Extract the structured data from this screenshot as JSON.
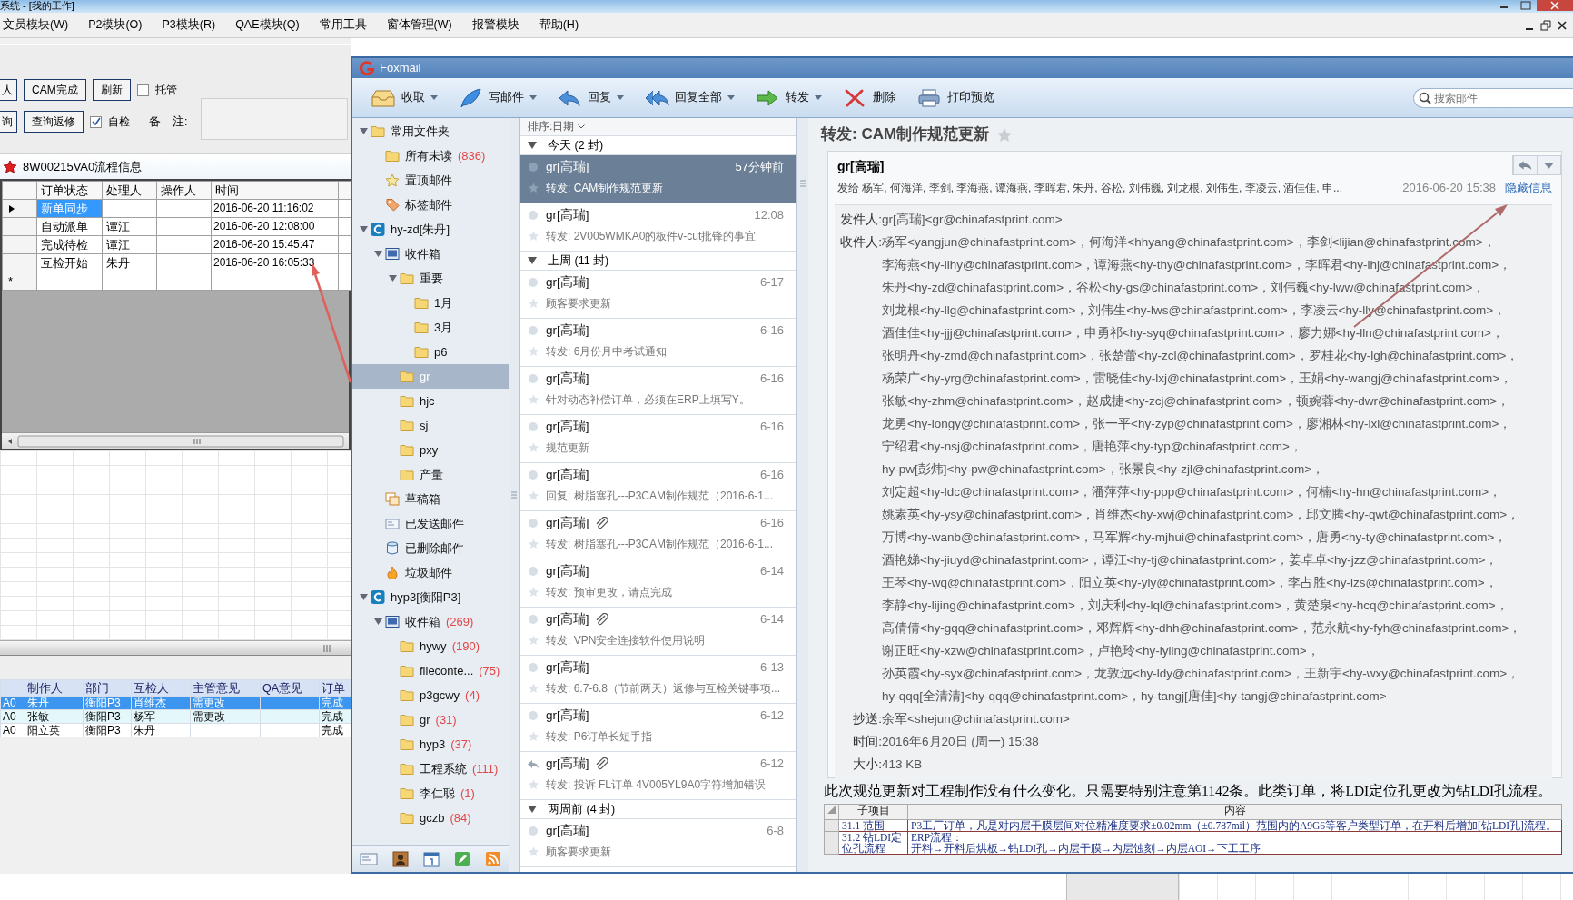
{
  "app": {
    "title": "系统 - [我的工作]",
    "menu": [
      "文员模块(W)",
      "P2模块(O)",
      "P3模块(R)",
      "QAE模块(Q)",
      "常用工具",
      "窗体管理(W)",
      "报警模块",
      "帮助(H)"
    ],
    "actions": [
      {
        "kind": "button",
        "label": "人"
      },
      {
        "kind": "button",
        "label": "CAM完成"
      },
      {
        "kind": "button",
        "label": "刷新"
      },
      {
        "kind": "checkbox",
        "label": "托管",
        "checked": false
      }
    ],
    "actions_row2": [
      {
        "kind": "button",
        "label": "询"
      },
      {
        "kind": "button",
        "label": "查询返修"
      },
      {
        "kind": "checkbox",
        "label": "自检",
        "checked": true
      }
    ],
    "remark_label": "备　注:",
    "flow": {
      "title": "8W00215VA0流程信息",
      "columns": [
        "订单状态",
        "处理人",
        "操作人",
        "时间"
      ],
      "rows": [
        {
          "current": true,
          "selected": true,
          "cells": [
            "新单同步",
            null,
            null,
            "2016-06-20 11:16:02"
          ]
        },
        {
          "current": false,
          "selected": false,
          "cells": [
            "自动派单",
            "谭江",
            null,
            "2016-06-20 12:08:00"
          ]
        },
        {
          "current": false,
          "selected": false,
          "cells": [
            "完成待检",
            "谭江",
            null,
            "2016-06-20 15:45:47"
          ]
        },
        {
          "current": false,
          "selected": false,
          "cells": [
            "互检开始",
            "朱丹",
            null,
            "2016-06-20 16:05:33"
          ]
        }
      ],
      "new_row_marker": "*"
    },
    "orders": {
      "columns": [
        "制作人",
        "部门",
        "互检人",
        "主管意见",
        "QA意见",
        "订单"
      ],
      "rows": [
        {
          "lead": "A0",
          "selected": true,
          "cells": [
            "朱丹",
            "衡阳P3",
            "肖维杰",
            "需更改",
            null,
            "完成"
          ]
        },
        {
          "lead": "A0",
          "selected": false,
          "cells": [
            "张敏",
            "衡阳P3",
            "杨军",
            "需更改",
            null,
            "完成"
          ]
        },
        {
          "lead": "A0",
          "selected": false,
          "cells": [
            "阳立英",
            "衡阳P3",
            "朱丹",
            null,
            null,
            "完成"
          ]
        }
      ]
    }
  },
  "foxmail": {
    "title": "Foxmail",
    "toolbar": [
      {
        "kind": "receive",
        "label": "收取",
        "dropdown": true
      },
      {
        "kind": "compose",
        "label": "写邮件",
        "dropdown": true
      },
      {
        "kind": "reply",
        "label": "回复",
        "dropdown": true
      },
      {
        "kind": "replyall",
        "label": "回复全部",
        "dropdown": true
      },
      {
        "kind": "forward",
        "label": "转发",
        "dropdown": true
      },
      {
        "kind": "delete",
        "label": "删除",
        "dropdown": false
      },
      {
        "kind": "print",
        "label": "打印预览",
        "dropdown": false
      }
    ],
    "search": {
      "placeholder": "搜索邮件"
    },
    "folders": [
      {
        "label": "常用文件夹",
        "kind": "folder",
        "expanded": true,
        "selected": false,
        "children": [
          {
            "label": "所有未读",
            "kind": "folder",
            "count": "(836)",
            "selected": false
          },
          {
            "label": "置顶邮件",
            "kind": "starred",
            "selected": false
          },
          {
            "label": "标签邮件",
            "kind": "tagged",
            "selected": false
          }
        ]
      },
      {
        "label": "hy-zd[朱丹]",
        "kind": "account",
        "expanded": true,
        "selected": false,
        "children": [
          {
            "label": "收件箱",
            "kind": "inbox",
            "expanded": true,
            "selected": false,
            "children": [
              {
                "label": "重要",
                "kind": "folder",
                "expanded": true,
                "selected": false,
                "children": [
                  {
                    "label": "1月",
                    "kind": "folder",
                    "selected": false
                  },
                  {
                    "label": "3月",
                    "kind": "folder",
                    "selected": false
                  },
                  {
                    "label": "p6",
                    "kind": "folder",
                    "selected": false
                  }
                ]
              },
              {
                "label": "gr",
                "kind": "folder",
                "selected": true
              },
              {
                "label": "hjc",
                "kind": "folder",
                "selected": false
              },
              {
                "label": "sj",
                "kind": "folder",
                "selected": false
              },
              {
                "label": "pxy",
                "kind": "folder",
                "selected": false
              },
              {
                "label": "产量",
                "kind": "folder",
                "selected": false
              }
            ]
          },
          {
            "label": "草稿箱",
            "kind": "drafts",
            "selected": false
          },
          {
            "label": "已发送邮件",
            "kind": "sent",
            "selected": false
          },
          {
            "label": "已删除邮件",
            "kind": "deleted",
            "selected": false
          },
          {
            "label": "垃圾邮件",
            "kind": "junk",
            "selected": false
          }
        ]
      },
      {
        "label": "hyp3[衡阳P3]",
        "kind": "account",
        "expanded": true,
        "selected": false,
        "children": [
          {
            "label": "收件箱",
            "kind": "inbox",
            "count": "(269)",
            "expanded": true,
            "selected": false,
            "children": [
              {
                "label": "hywy",
                "kind": "folder",
                "count": "(190)",
                "selected": false
              },
              {
                "label": "fileconte...",
                "kind": "folder",
                "count": "(75)",
                "selected": false
              },
              {
                "label": "p3gcwy",
                "kind": "folder",
                "count": "(4)",
                "selected": false
              },
              {
                "label": "gr",
                "kind": "folder",
                "count": "(31)",
                "selected": false
              },
              {
                "label": "hyp3",
                "kind": "folder",
                "count": "(37)",
                "selected": false
              },
              {
                "label": "工程系统",
                "kind": "folder",
                "count": "(111)",
                "selected": false
              },
              {
                "label": "李仁聪",
                "kind": "folder",
                "count": "(1)",
                "selected": false
              },
              {
                "label": "gczb",
                "kind": "folder",
                "count": "(84)",
                "selected": false
              }
            ]
          }
        ]
      }
    ],
    "sort": "排序:日期",
    "groups": [
      {
        "label": "今天 (2 封)",
        "expanded": true,
        "messages": [
          {
            "sender": "gr[高瑞]",
            "time": "57分钟前",
            "subject": "转发: CAM制作规范更新",
            "selected": true,
            "attachment": false,
            "replied": false
          },
          {
            "sender": "gr[高瑞]",
            "time": "12:08",
            "subject": "转发: 2V005WMKA0的板件v-cut批锋的事宜",
            "selected": false,
            "attachment": false,
            "replied": false
          }
        ]
      },
      {
        "label": "上周 (11 封)",
        "expanded": true,
        "messages": [
          {
            "sender": "gr[高瑞]",
            "time": "6-17",
            "subject": "顾客要求更新",
            "selected": false,
            "attachment": false,
            "replied": false
          },
          {
            "sender": "gr[高瑞]",
            "time": "6-16",
            "subject": "转发: 6月份月中考试通知",
            "selected": false,
            "attachment": false,
            "replied": false
          },
          {
            "sender": "gr[高瑞]",
            "time": "6-16",
            "subject": "针对动态补偿订单，必须在ERP上填写Y。",
            "selected": false,
            "attachment": false,
            "replied": false
          },
          {
            "sender": "gr[高瑞]",
            "time": "6-16",
            "subject": "规范更新",
            "selected": false,
            "attachment": false,
            "replied": false
          },
          {
            "sender": "gr[高瑞]",
            "time": "6-16",
            "subject": "回复: 树脂塞孔---P3CAM制作规范（2016-6-1...",
            "selected": false,
            "attachment": false,
            "replied": false
          },
          {
            "sender": "gr[高瑞]",
            "time": "6-16",
            "subject": "转发: 树脂塞孔---P3CAM制作规范（2016-6-1...",
            "selected": false,
            "attachment": true,
            "replied": false
          },
          {
            "sender": "gr[高瑞]",
            "time": "6-14",
            "subject": "转发: 预审更改，请点完成",
            "selected": false,
            "attachment": false,
            "replied": false
          },
          {
            "sender": "gr[高瑞]",
            "time": "6-14",
            "subject": "转发: VPN安全连接软件使用说明",
            "selected": false,
            "attachment": true,
            "replied": false
          },
          {
            "sender": "gr[高瑞]",
            "time": "6-13",
            "subject": "转发: 6.7-6.8（节前两天）返修与互检关键事项...",
            "selected": false,
            "attachment": false,
            "replied": false
          },
          {
            "sender": "gr[高瑞]",
            "time": "6-12",
            "subject": "转发: P6订单长短手指",
            "selected": false,
            "attachment": false,
            "replied": false
          },
          {
            "sender": "gr[高瑞]",
            "time": "6-12",
            "subject": "转发: 投诉 FL订单  4V005YL9A0字符增加错误",
            "selected": false,
            "attachment": true,
            "replied": true
          }
        ]
      },
      {
        "label": "两周前 (4 封)",
        "expanded": true,
        "messages": [
          {
            "sender": "gr[高瑞]",
            "time": "6-8",
            "subject": "顾客要求更新",
            "selected": false,
            "attachment": false,
            "replied": false
          }
        ]
      }
    ],
    "message": {
      "subject": "转发: CAM制作规范更新",
      "starred": false,
      "from": "gr[高瑞]",
      "to_summary": "发给 杨军, 何海洋, 李剑, 李海燕, 谭海燕, 李晖君, 朱丹, 谷松, 刘伟巍, 刘龙根, 刘伟生, 李凌云, 酒佳佳, 申...",
      "date": "2016-06-20 15:38",
      "hide_link": "隐藏信息",
      "details": [
        {
          "label": "发件人:",
          "lines": [
            "gr[高瑞]<gr@chinafastprint.com>"
          ]
        },
        {
          "label": "收件人:",
          "lines": [
            "杨军<yangjun@chinafastprint.com>，何海洋<hhyang@chinafastprint.com>，李剑<lijian@chinafastprint.com>，",
            "李海燕<hy-lihy@chinafastprint.com>，谭海燕<hy-thy@chinafastprint.com>，李晖君<hy-lhj@chinafastprint.com>，",
            "朱丹<hy-zd@chinafastprint.com>，谷松<hy-gs@chinafastprint.com>，刘伟巍<hy-lww@chinafastprint.com>，",
            "刘龙根<hy-llg@chinafastprint.com>，刘伟生<hy-lws@chinafastprint.com>，李凌云<hy-lly@chinafastprint.com>，",
            "酒佳佳<hy-jjj@chinafastprint.com>，申勇祁<hy-syq@chinafastprint.com>，廖力娜<hy-lln@chinafastprint.com>，",
            "张明丹<hy-zmd@chinafastprint.com>，张楚蕾<hy-zcl@chinafastprint.com>，罗桂花<hy-lgh@chinafastprint.com>，",
            "杨荣广<hy-yrg@chinafastprint.com>，雷晓佳<hy-lxj@chinafastprint.com>，王娟<hy-wangj@chinafastprint.com>，",
            "张敏<hy-zhm@chinafastprint.com>，赵成捷<hy-zcj@chinafastprint.com>，顿婉蓉<hy-dwr@chinafastprint.com>，",
            "龙勇<hy-longy@chinafastprint.com>，张一平<hy-zyp@chinafastprint.com>，廖湘林<hy-lxl@chinafastprint.com>，",
            "宁绍君<hy-nsj@chinafastprint.com>，唐艳萍<hy-typ@chinafastprint.com>，",
            "hy-pw[彭炜]<hy-pw@chinafastprint.com>，张景良<hy-zjl@chinafastprint.com>，",
            "刘定超<hy-ldc@chinafastprint.com>，潘萍萍<hy-ppp@chinafastprint.com>，何楠<hy-hn@chinafastprint.com>，",
            "姚素英<hy-ysy@chinafastprint.com>，肖维杰<hy-xwj@chinafastprint.com>，邱文腾<hy-qwt@chinafastprint.com>，",
            "万博<hy-wanb@chinafastprint.com>，马军辉<hy-mjhui@chinafastprint.com>，唐勇<hy-ty@chinafastprint.com>，",
            "酒艳娣<hy-jiuyd@chinafastprint.com>，谭江<hy-tj@chinafastprint.com>，姜卓卓<hy-jzz@chinafastprint.com>，",
            "王琴<hy-wq@chinafastprint.com>，阳立英<hy-yly@chinafastprint.com>，李占胜<hy-lzs@chinafastprint.com>，",
            "李静<hy-lijing@chinafastprint.com>，刘庆利<hy-lql@chinafastprint.com>，黄楚泉<hy-hcq@chinafastprint.com>，",
            "高倩倩<hy-gqq@chinafastprint.com>，邓辉辉<hy-dhh@chinafastprint.com>，范永航<hy-fyh@chinafastprint.com>，",
            "谢正旺<hy-xzw@chinafastprint.com>，卢艳玲<hy-lyling@chinafastprint.com>，",
            "孙英霞<hy-syx@chinafastprint.com>，龙敦远<hy-ldy@chinafastprint.com>，王新宇<hy-wxy@chinafastprint.com>，",
            "hy-qqq[全清清]<hy-qqq@chinafastprint.com>，hy-tangj[唐佳]<hy-tangj@chinafastprint.com>"
          ]
        },
        {
          "label": "抄送:",
          "lines": [
            "余军<shejun@chinafastprint.com>"
          ]
        },
        {
          "label": "时间:",
          "lines": [
            "2016年6月20日 (周一) 15:38"
          ]
        },
        {
          "label": "大小:",
          "lines": [
            "413 KB"
          ]
        }
      ],
      "body": "此次规范更新对工程制作没有什么变化。只需要特别注意第1142条。此类订单，将LDI定位孔更改为钻LDI孔流程。",
      "table": {
        "columns": [
          "子项目",
          "内容"
        ],
        "rows": [
          {
            "item": "31.1 范围",
            "content": [
              "P3工厂订单，凡是对内层干膜层间对位精准度要求±0.02mm（±0.787mil）范围内的A9G6等客户类型订单，在开料后增加[钻LDI孔]流程。"
            ]
          },
          {
            "item": "31.2 钻LDI定位孔流程",
            "content": [
              "ERP流程：",
              "开料→开料后烘板→钻LDI孔→内层干膜→内层蚀刻→内层AOI→下工工序"
            ]
          }
        ]
      }
    }
  }
}
